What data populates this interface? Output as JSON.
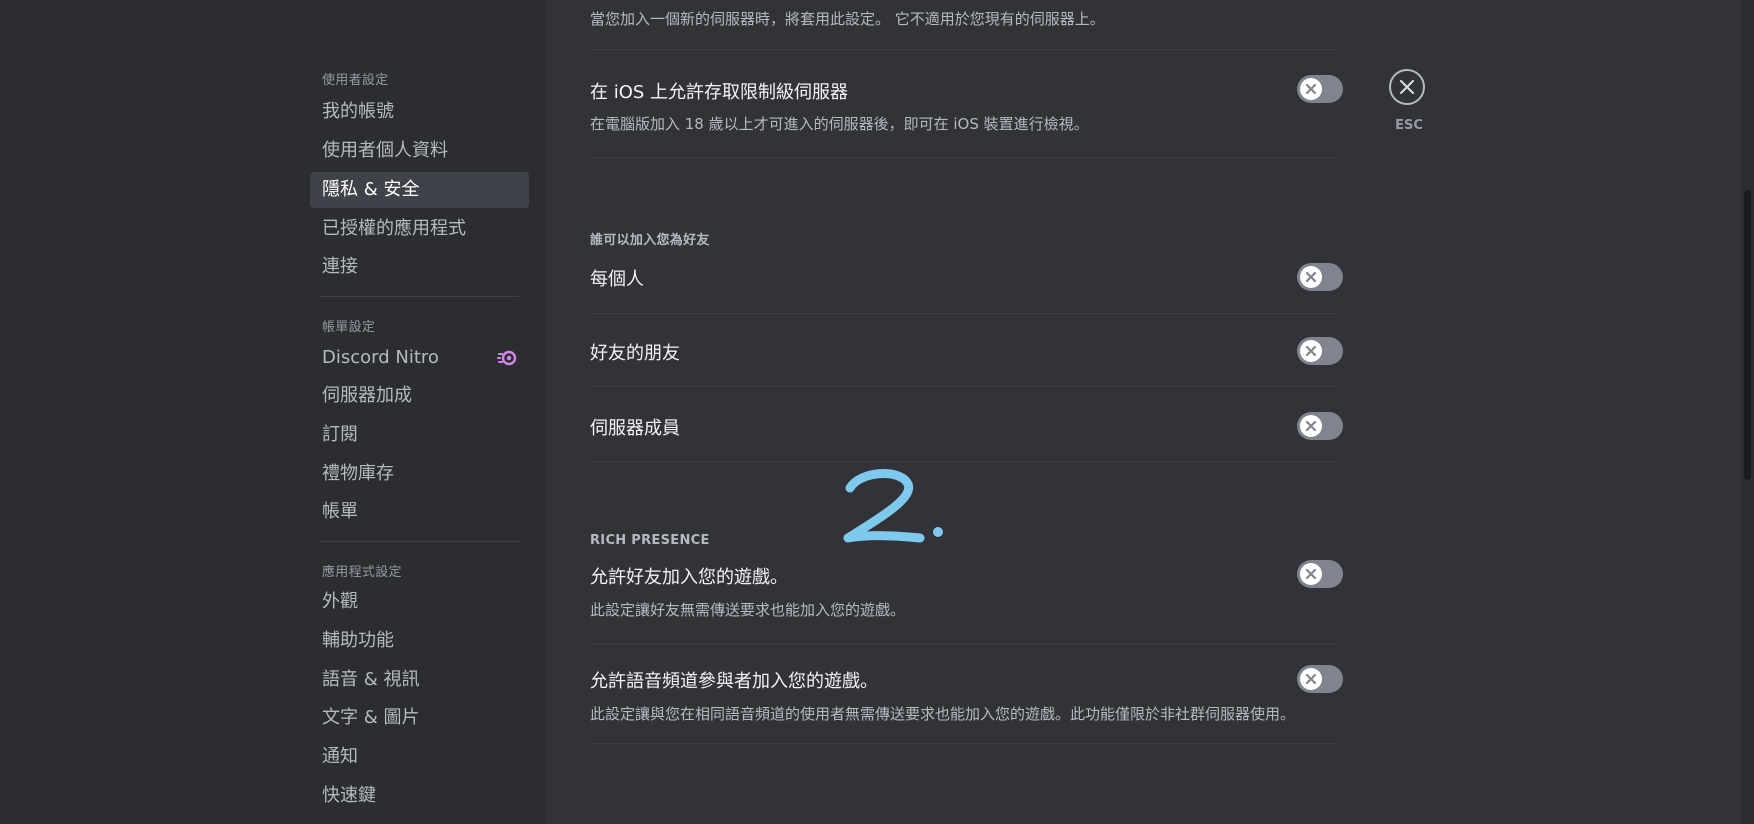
{
  "sidebar": {
    "sections": [
      {
        "header": "使用者設定",
        "items": [
          {
            "label": "我的帳號"
          },
          {
            "label": "使用者個人資料"
          },
          {
            "label": "隱私 & 安全",
            "active": true
          },
          {
            "label": "已授權的應用程式"
          },
          {
            "label": "連接"
          }
        ]
      },
      {
        "header": "帳單設定",
        "items": [
          {
            "label": "Discord Nitro",
            "icon": "nitro-icon"
          },
          {
            "label": "伺服器加成"
          },
          {
            "label": "訂閱"
          },
          {
            "label": "禮物庫存"
          },
          {
            "label": "帳單"
          }
        ]
      },
      {
        "header": "應用程式設定",
        "items": [
          {
            "label": "外觀"
          },
          {
            "label": "輔助功能"
          },
          {
            "label": "語音 & 視訊"
          },
          {
            "label": "文字 & 圖片"
          },
          {
            "label": "通知"
          },
          {
            "label": "快速鍵"
          }
        ]
      }
    ]
  },
  "content": {
    "top_desc": "當您加入一個新的伺服器時，將套用此設定。 它不適用於您現有的伺服器上。",
    "ios_setting": {
      "title": "在 iOS 上允許存取限制級伺服器",
      "desc": "在電腦版加入 18 歲以上才可進入的伺服器後，即可在 iOS 裝置進行檢視。",
      "enabled": false
    },
    "friend_section": {
      "header": "誰可以加入您為好友",
      "rows": [
        {
          "title": "每個人",
          "enabled": false
        },
        {
          "title": "好友的朋友",
          "enabled": false
        },
        {
          "title": "伺服器成員",
          "enabled": false
        }
      ]
    },
    "rich_presence": {
      "header": "RICH PRESENCE",
      "rows": [
        {
          "title": "允許好友加入您的遊戲。",
          "desc": "此設定讓好友無需傳送要求也能加入您的遊戲。",
          "enabled": false
        },
        {
          "title": "允許語音頻道參與者加入您的遊戲。",
          "desc": "此設定讓與您在相同語音頻道的使用者無需傳送要求也能加入您的遊戲。此功能僅限於非社群伺服器使用。",
          "enabled": false
        }
      ]
    },
    "annotation_text": "2."
  },
  "close": {
    "label": "ESC"
  },
  "colors": {
    "background": "#313338",
    "sidebar": "#2b2d31",
    "toggle_off": "#80848e",
    "nitro": "#d386e8",
    "annotation": "#7fc8ee"
  }
}
